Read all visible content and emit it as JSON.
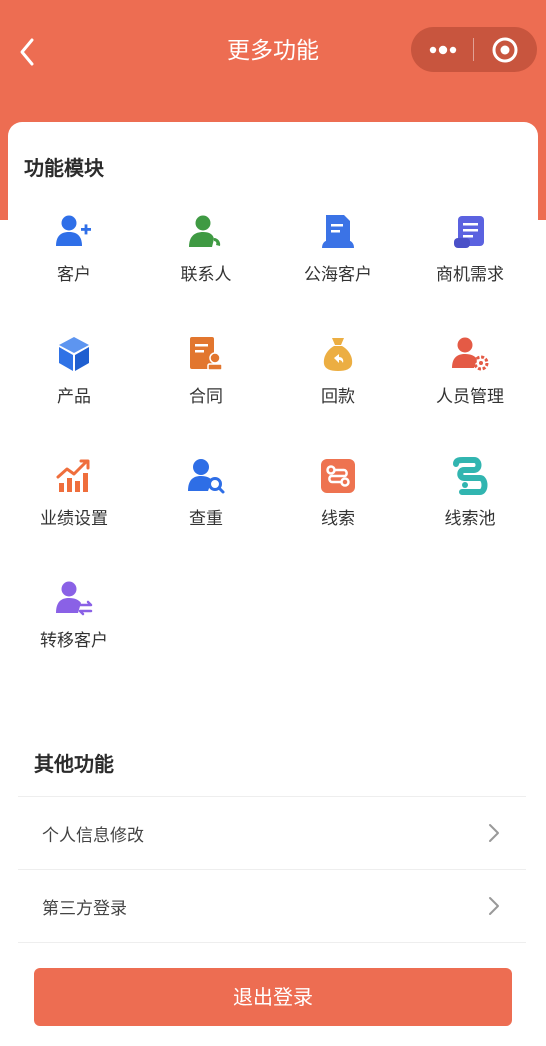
{
  "colors": {
    "brand": "#ed6d52",
    "background": "#ffffff",
    "text": "#333333"
  },
  "header": {
    "back_icon": "chevron-left-icon",
    "title": "更多功能",
    "capsule_icons": [
      "more-dots-icon",
      "target-close-icon"
    ]
  },
  "modules": {
    "title": "功能模块",
    "items": [
      {
        "label": "客户",
        "icon": "user-plus-icon",
        "color": "#2f6fe8"
      },
      {
        "label": "联系人",
        "icon": "user-phone-icon",
        "color": "#3f9a43"
      },
      {
        "label": "公海客户",
        "icon": "document-users-icon",
        "color": "#3b73e6"
      },
      {
        "label": "商机需求",
        "icon": "scroll-icon",
        "color": "#5b62e0"
      },
      {
        "label": "产品",
        "icon": "cube-icon",
        "color": "#2f72e6"
      },
      {
        "label": "合同",
        "icon": "contract-seal-icon",
        "color": "#e2762e"
      },
      {
        "label": "回款",
        "icon": "money-bag-icon",
        "color": "#ecae42"
      },
      {
        "label": "人员管理",
        "icon": "user-gear-icon",
        "color": "#e45a45"
      },
      {
        "label": "业绩设置",
        "icon": "bar-chart-trend-icon",
        "color": "#ef6e3c"
      },
      {
        "label": "查重",
        "icon": "user-search-icon",
        "color": "#2e6ee6"
      },
      {
        "label": "线索",
        "icon": "clue-route-icon",
        "color": "#ee7350"
      },
      {
        "label": "线索池",
        "icon": "clue-pool-icon",
        "color": "#31b5b0"
      },
      {
        "label": "转移客户",
        "icon": "user-transfer-icon",
        "color": "#8a61e6"
      }
    ]
  },
  "other": {
    "title": "其他功能",
    "items": [
      {
        "label": "个人信息修改",
        "icon": "chevron-right-icon"
      },
      {
        "label": "第三方登录",
        "icon": "chevron-right-icon"
      }
    ]
  },
  "logout_label": "退出登录"
}
